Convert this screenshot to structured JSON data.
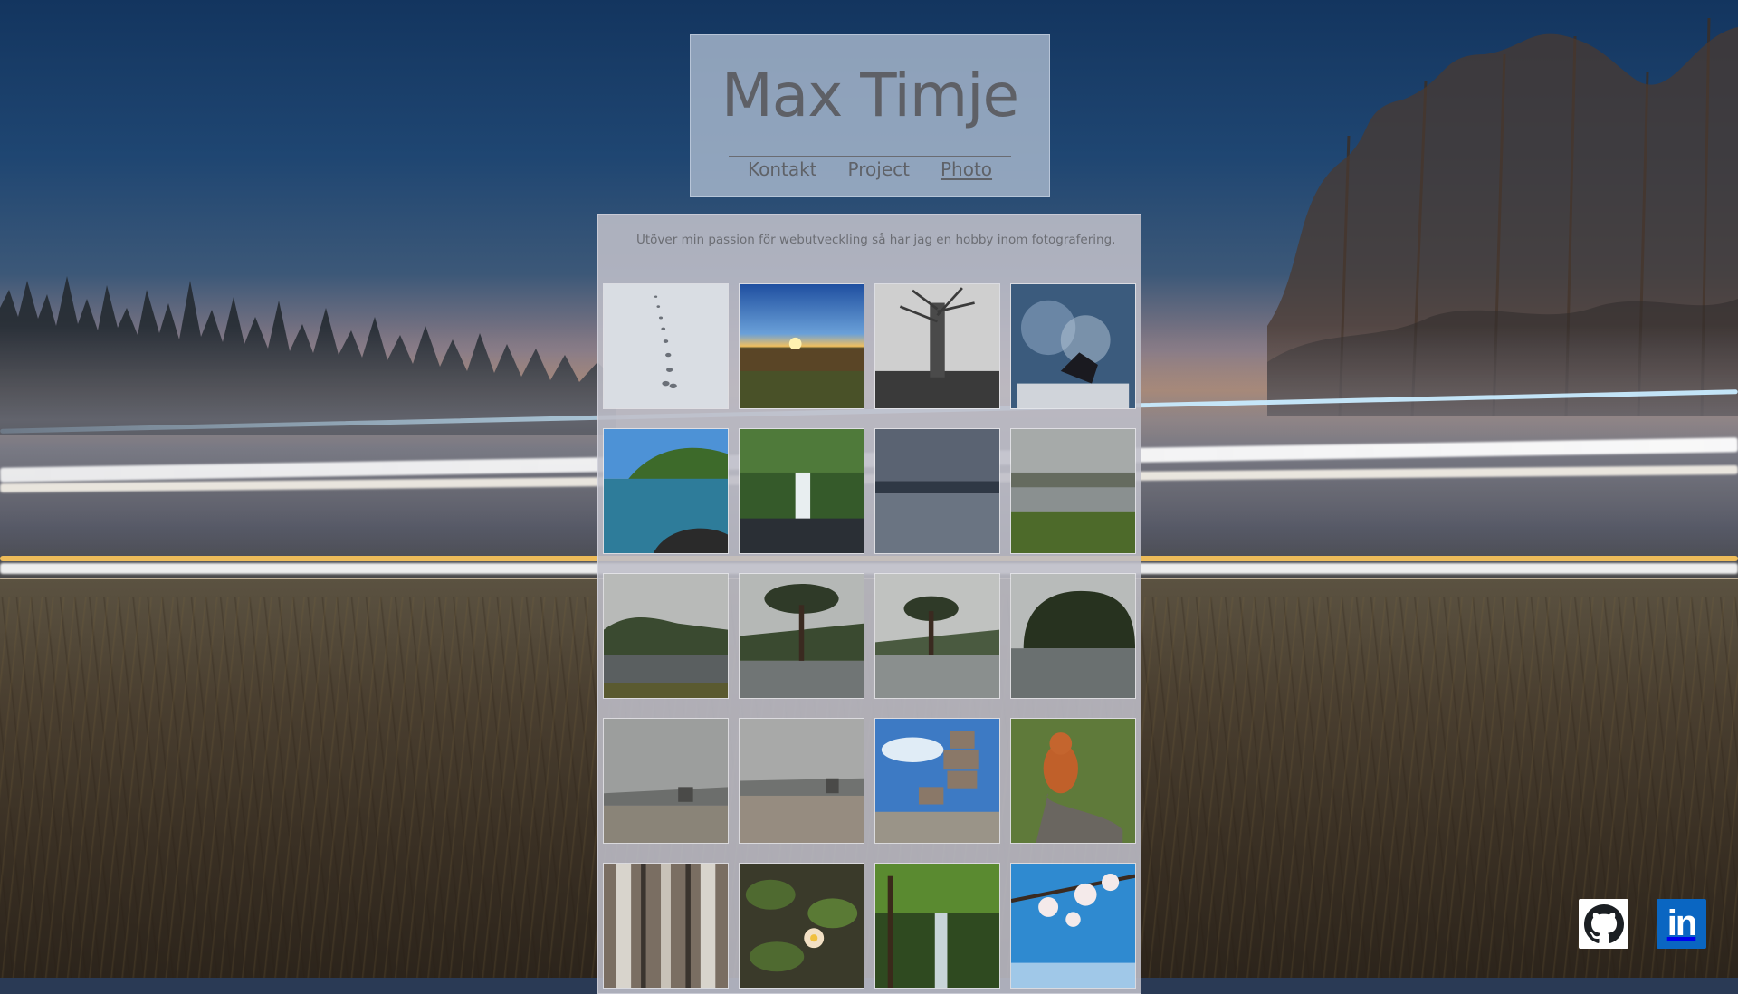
{
  "site": {
    "title": "Max Timje",
    "nav": [
      {
        "label": "Kontakt",
        "active": false
      },
      {
        "label": "Project",
        "active": false
      },
      {
        "label": "Photo",
        "active": true
      }
    ]
  },
  "main": {
    "intro": "Utöver min passion för webutveckling så har jag en hobby inom fotografering."
  },
  "gallery": [
    {
      "name": "photo-footprints-snow"
    },
    {
      "name": "photo-sunset-field"
    },
    {
      "name": "photo-dead-tree-bw"
    },
    {
      "name": "photo-smoke-bowl"
    },
    {
      "name": "photo-lake-shore"
    },
    {
      "name": "photo-waterfall"
    },
    {
      "name": "photo-calm-lake"
    },
    {
      "name": "photo-misty-lake"
    },
    {
      "name": "photo-island-trees"
    },
    {
      "name": "photo-pine-tree"
    },
    {
      "name": "photo-pine-lake"
    },
    {
      "name": "photo-pine-island"
    },
    {
      "name": "photo-castle-beach"
    },
    {
      "name": "photo-castle-beach-2"
    },
    {
      "name": "photo-stone-cairn"
    },
    {
      "name": "photo-red-squirrel"
    },
    {
      "name": "photo-bridge-underside"
    },
    {
      "name": "photo-water-lily"
    },
    {
      "name": "photo-forest-stream"
    },
    {
      "name": "photo-cherry-blossom"
    }
  ],
  "social": {
    "github_icon": "github-icon",
    "linkedin_icon": "linkedin-icon",
    "linkedin_text": "in"
  }
}
